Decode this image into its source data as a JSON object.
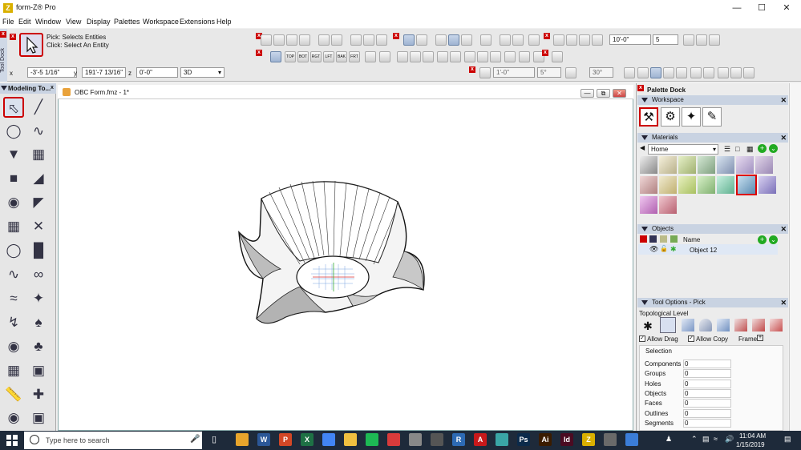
{
  "app": {
    "title": "form-Z® Pro",
    "icon_letter": "Z"
  },
  "window_controls": {
    "minimize": "—",
    "maximize": "☐",
    "close": "✕"
  },
  "menu": [
    "File",
    "Edit",
    "Window",
    "View",
    "Display",
    "Palettes",
    "Workspace",
    "Extensions",
    "Help"
  ],
  "tool_dock": {
    "label": "Tool Dock",
    "pick_line1": "Pick:   Selects Entities",
    "pick_line2": "Click: Select An Entity",
    "view_buttons": [
      "TOP",
      "BOT",
      "RGT",
      "LFT",
      "BAK",
      "FRT"
    ],
    "grid_value": "10'-0\"",
    "grid_count": "5",
    "angle_value": "1'-0\"",
    "angle_value2": "5°",
    "rotation_value": "30°"
  },
  "coords": {
    "x_label": "x",
    "x_value": "-3'-5 1/16\"",
    "y_label": "y",
    "y_value": "191'-7 13/16\"",
    "z_label": "z",
    "z_value": "0'-0\"",
    "mode_value": "3D"
  },
  "modeling_palette": {
    "title": "Modeling To..."
  },
  "document": {
    "title": "OBC Form.fmz - 1*",
    "minimize_label": "—",
    "restore_label": "⧉",
    "close_label": "✕"
  },
  "palette_dock": {
    "title": "Palette Dock",
    "workspace_title": "Workspace",
    "materials_title": "Materials",
    "materials_library": "Home",
    "objects_title": "Objects",
    "objects_name_col": "Name",
    "object_row": "Object 12",
    "tool_options_title": "Tool Options - Pick",
    "topological_level": "Topological Level",
    "allow_drag": "Allow Drag",
    "allow_copy": "Allow Copy",
    "frame_label": "Frame",
    "selection_title": "Selection",
    "selection_rows": [
      {
        "label": "Components",
        "value": "0"
      },
      {
        "label": "Groups",
        "value": "0"
      },
      {
        "label": "Holes",
        "value": "0"
      },
      {
        "label": "Objects",
        "value": "0"
      },
      {
        "label": "Faces",
        "value": "0"
      },
      {
        "label": "Outlines",
        "value": "0"
      },
      {
        "label": "Segments",
        "value": "0"
      }
    ]
  },
  "taskbar": {
    "search_placeholder": "Type here to search",
    "time": "11:04 AM",
    "date": "1/15/2019",
    "apps": [
      {
        "name": "chrome",
        "letter": "",
        "color": "#e8a52c"
      },
      {
        "name": "word",
        "letter": "W",
        "color": "#2b5797"
      },
      {
        "name": "powerpoint",
        "letter": "P",
        "color": "#d24726"
      },
      {
        "name": "excel",
        "letter": "X",
        "color": "#1e7145"
      },
      {
        "name": "docs",
        "letter": "",
        "color": "#4285f4"
      },
      {
        "name": "explorer",
        "letter": "",
        "color": "#f0c040"
      },
      {
        "name": "spotify",
        "letter": "",
        "color": "#1db954"
      },
      {
        "name": "app-red",
        "letter": "",
        "color": "#d83b3b"
      },
      {
        "name": "app-gray",
        "letter": "",
        "color": "#888888"
      },
      {
        "name": "app-dark",
        "letter": "",
        "color": "#555555"
      },
      {
        "name": "revit",
        "letter": "R",
        "color": "#2d6ab3"
      },
      {
        "name": "acrobat",
        "letter": "A",
        "color": "#c8191b"
      },
      {
        "name": "app-teal",
        "letter": "",
        "color": "#3aa6a6"
      },
      {
        "name": "photoshop",
        "letter": "Ps",
        "color": "#0b2a4a"
      },
      {
        "name": "illustrator",
        "letter": "Ai",
        "color": "#3a1c00"
      },
      {
        "name": "indesign",
        "letter": "Id",
        "color": "#4b0b22"
      },
      {
        "name": "formz",
        "letter": "Z",
        "color": "#d9b000"
      },
      {
        "name": "photos",
        "letter": "",
        "color": "#6a6a6a"
      },
      {
        "name": "app-blue",
        "letter": "",
        "color": "#3b7dd8"
      }
    ]
  },
  "colors": {
    "accent_red": "#cc0000",
    "palette_header": "#c9d3e2",
    "taskbar": "#1e2a3a"
  }
}
